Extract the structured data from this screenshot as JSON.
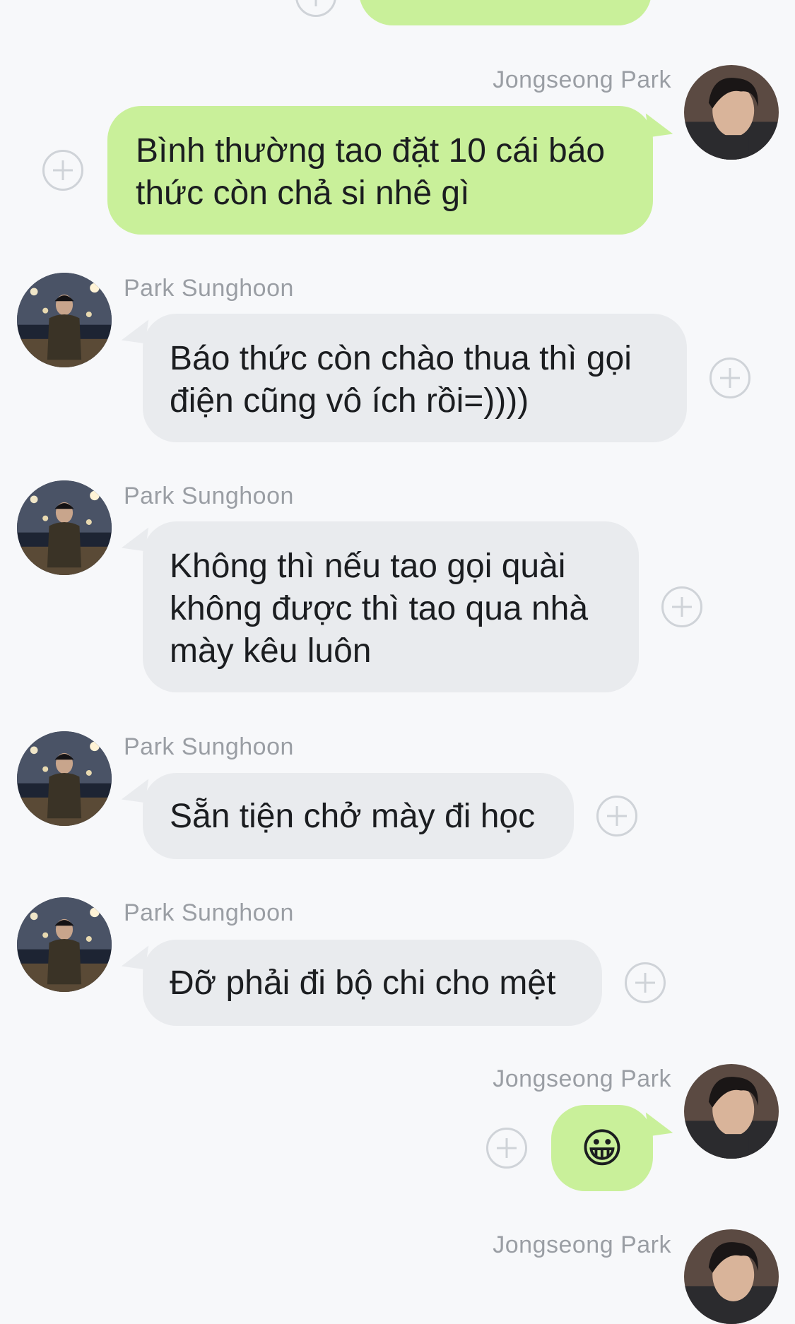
{
  "contacts": {
    "outgoing_name": "Jongseong Park",
    "incoming_name": "Park Sunghoon"
  },
  "top_partial": {
    "emoji": "😀"
  },
  "messages": [
    {
      "sender": "Jongseong Park",
      "direction": "out",
      "text": "Bình thường tao đặt 10 cái báo\nthức còn chả si nhê gì"
    },
    {
      "sender": "Park Sunghoon",
      "direction": "in",
      "text": "Báo thức còn chào thua thì gọi\nđiện cũng vô ích rồi=))))"
    },
    {
      "sender": "Park Sunghoon",
      "direction": "in",
      "text": "Không thì nếu tao gọi quài\nkhông được thì tao qua nhà\nmày kêu luôn"
    },
    {
      "sender": "Park Sunghoon",
      "direction": "in",
      "text": "Sẵn tiện chở mày đi học"
    },
    {
      "sender": "Park Sunghoon",
      "direction": "in",
      "text": "Đỡ phải đi bộ chi cho mệt"
    },
    {
      "sender": "Jongseong Park",
      "direction": "out",
      "text": "😀"
    },
    {
      "sender": "Jongseong Park",
      "direction": "out",
      "text": ""
    }
  ],
  "colors": {
    "outgoing_bubble": "#c9f09a",
    "incoming_bubble": "#e9ebee",
    "background": "#f7f8fa",
    "name_text": "#9a9ea4"
  }
}
